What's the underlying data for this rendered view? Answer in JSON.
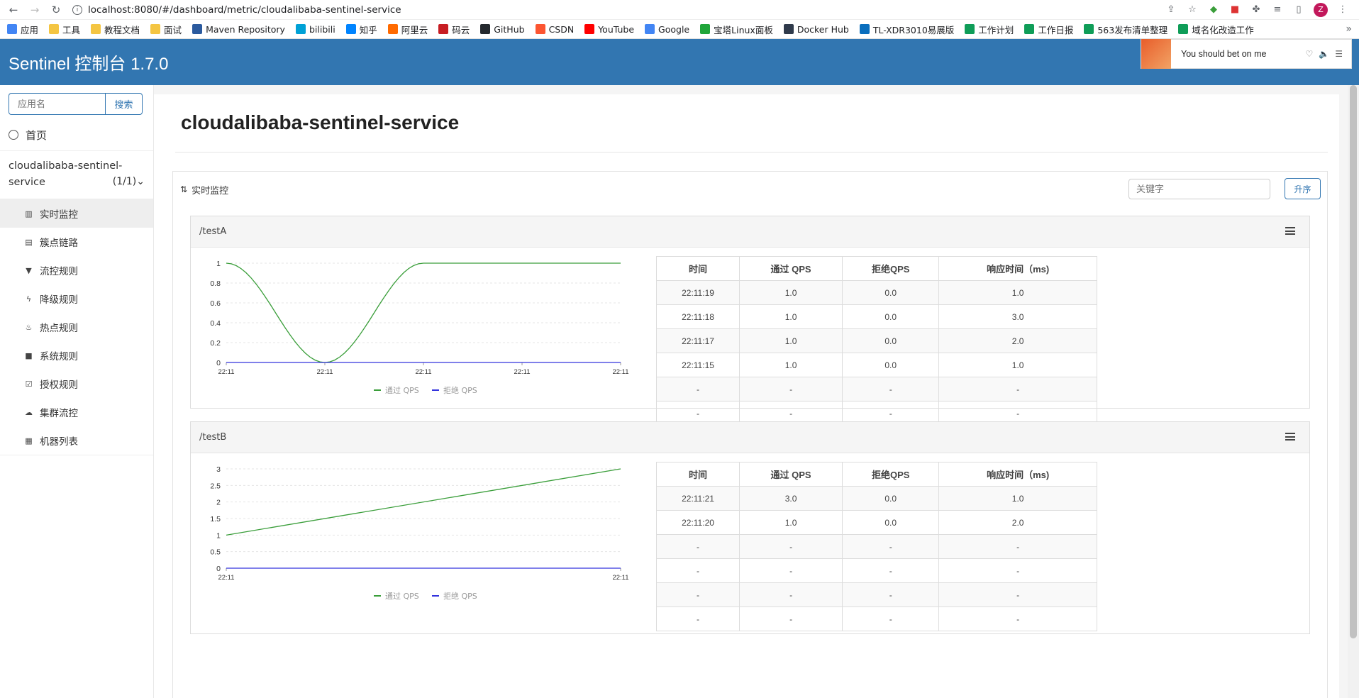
{
  "browser": {
    "url": "localhost:8080/#/dashboard/metric/cloudalibaba-sentinel-service",
    "avatar": "Z",
    "bookmarks": [
      {
        "label": "应用",
        "color": "#4285f4"
      },
      {
        "label": "工具",
        "color": "#f4c542"
      },
      {
        "label": "教程文档",
        "color": "#f4c542"
      },
      {
        "label": "面试",
        "color": "#f4c542"
      },
      {
        "label": "Maven Repository",
        "color": "#2b5a9e"
      },
      {
        "label": "bilibili",
        "color": "#00a1d6"
      },
      {
        "label": "知乎",
        "color": "#0084ff"
      },
      {
        "label": "阿里云",
        "color": "#ff6a00"
      },
      {
        "label": "码云",
        "color": "#c71d23"
      },
      {
        "label": "GitHub",
        "color": "#24292e"
      },
      {
        "label": "CSDN",
        "color": "#fc5531"
      },
      {
        "label": "YouTube",
        "color": "#ff0000"
      },
      {
        "label": "Google",
        "color": "#4285f4"
      },
      {
        "label": "宝塔Linux面板",
        "color": "#20a53a"
      },
      {
        "label": "Docker Hub",
        "color": "#2f3a4b"
      },
      {
        "label": "TL-XDR3010易展版",
        "color": "#0a6ebd"
      },
      {
        "label": "工作计划",
        "color": "#0f9d58"
      },
      {
        "label": "工作日报",
        "color": "#0f9d58"
      },
      {
        "label": "563发布清单整理",
        "color": "#0f9d58"
      },
      {
        "label": "域名化改造工作",
        "color": "#0f9d58"
      }
    ]
  },
  "header": {
    "brand": "Sentinel 控制台 1.7.0",
    "popup_text": "You should bet on me"
  },
  "sidebar": {
    "search_placeholder": "应用名",
    "search_button": "搜索",
    "home": "首页",
    "app_name_line1": "cloudalibaba-sentinel-",
    "app_name_line2": "service",
    "app_count": "(1/1)",
    "menu": [
      {
        "label": "实时监控",
        "icon": "bar-chart-icon",
        "glyph": "▥",
        "active": true
      },
      {
        "label": "簇点链路",
        "icon": "list-icon",
        "glyph": "▤",
        "active": false
      },
      {
        "label": "流控规则",
        "icon": "filter-icon",
        "glyph": "▼",
        "active": false
      },
      {
        "label": "降级规则",
        "icon": "flash-icon",
        "glyph": "ϟ",
        "active": false
      },
      {
        "label": "热点规则",
        "icon": "fire-icon",
        "glyph": "♨",
        "active": false
      },
      {
        "label": "系统规则",
        "icon": "lock-icon",
        "glyph": "■",
        "active": false
      },
      {
        "label": "授权规则",
        "icon": "check-square-icon",
        "glyph": "☑",
        "active": false
      },
      {
        "label": "集群流控",
        "icon": "cloud-icon",
        "glyph": "☁",
        "active": false
      },
      {
        "label": "机器列表",
        "icon": "th-list-icon",
        "glyph": "▦",
        "active": false
      }
    ]
  },
  "main": {
    "title": "cloudalibaba-sentinel-service",
    "panel_title": "实时监控",
    "keyword_placeholder": "关键字",
    "sort_button": "升序",
    "table_headers": [
      "时间",
      "通过 QPS",
      "拒绝QPS",
      "响应时间（ms)"
    ],
    "legend": {
      "pass": "通过 QPS",
      "block": "拒绝 QPS"
    },
    "colors": {
      "pass": "#3a9e3a",
      "block": "#3333dd"
    },
    "resources": [
      {
        "name": "/testA",
        "rows": [
          [
            "22:11:19",
            "1.0",
            "0.0",
            "1.0"
          ],
          [
            "22:11:18",
            "1.0",
            "0.0",
            "3.0"
          ],
          [
            "22:11:17",
            "1.0",
            "0.0",
            "2.0"
          ],
          [
            "22:11:15",
            "1.0",
            "0.0",
            "1.0"
          ],
          [
            "-",
            "-",
            "-",
            "-"
          ],
          [
            "-",
            "-",
            "-",
            "-"
          ]
        ]
      },
      {
        "name": "/testB",
        "rows": [
          [
            "22:11:21",
            "3.0",
            "0.0",
            "1.0"
          ],
          [
            "22:11:20",
            "1.0",
            "0.0",
            "2.0"
          ],
          [
            "-",
            "-",
            "-",
            "-"
          ],
          [
            "-",
            "-",
            "-",
            "-"
          ],
          [
            "-",
            "-",
            "-",
            "-"
          ],
          [
            "-",
            "-",
            "-",
            "-"
          ]
        ]
      }
    ]
  },
  "chart_data": [
    {
      "type": "line",
      "x": [
        "22:11",
        "22:11",
        "22:11",
        "22:11",
        "22:11"
      ],
      "ylim": [
        0,
        1
      ],
      "yticks": [
        0,
        0.2,
        0.4,
        0.6,
        0.8,
        1
      ],
      "series": [
        {
          "name": "通过 QPS",
          "values": [
            1,
            0,
            1,
            1,
            1
          ]
        },
        {
          "name": "拒绝 QPS",
          "values": [
            0,
            0,
            0,
            0,
            0
          ]
        }
      ]
    },
    {
      "type": "line",
      "x": [
        "22:11",
        "22:11"
      ],
      "ylim": [
        0,
        3
      ],
      "yticks": [
        0,
        0.5,
        1,
        1.5,
        2,
        2.5,
        3
      ],
      "series": [
        {
          "name": "通过 QPS",
          "values": [
            1,
            3
          ]
        },
        {
          "name": "拒绝 QPS",
          "values": [
            0,
            0
          ]
        }
      ]
    }
  ]
}
